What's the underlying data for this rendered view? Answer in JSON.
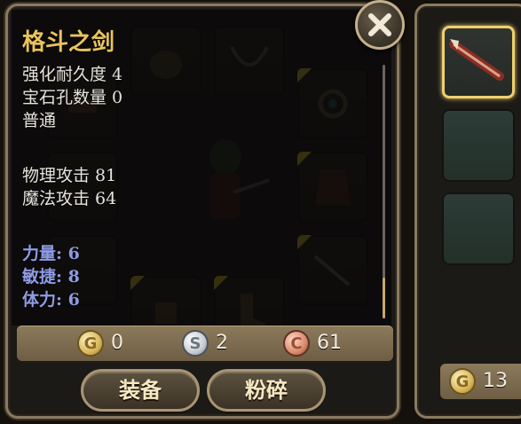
{
  "item": {
    "name": "格斗之剑",
    "enhance_durability": "强化耐久度 4",
    "gem_slots": "宝石孔数量 0",
    "quality": "普通",
    "physical_attack": "物理攻击 81",
    "magic_attack": "魔法攻击 64",
    "strength": "力量: 6",
    "agility": "敏捷: 8",
    "stamina": "体力: 6"
  },
  "currency": {
    "gold": "0",
    "silver": "2",
    "copper": "61",
    "coin_letters": {
      "gold": "G",
      "silver": "S",
      "copper": "C"
    }
  },
  "buttons": {
    "equip": "装备",
    "smash": "粉碎"
  },
  "side_panel": {
    "gold_amount": "13"
  },
  "colors": {
    "item_name": "#e9c45b",
    "stat_bonus": "#8f9be3",
    "selected_border": "#f0cf6e"
  }
}
